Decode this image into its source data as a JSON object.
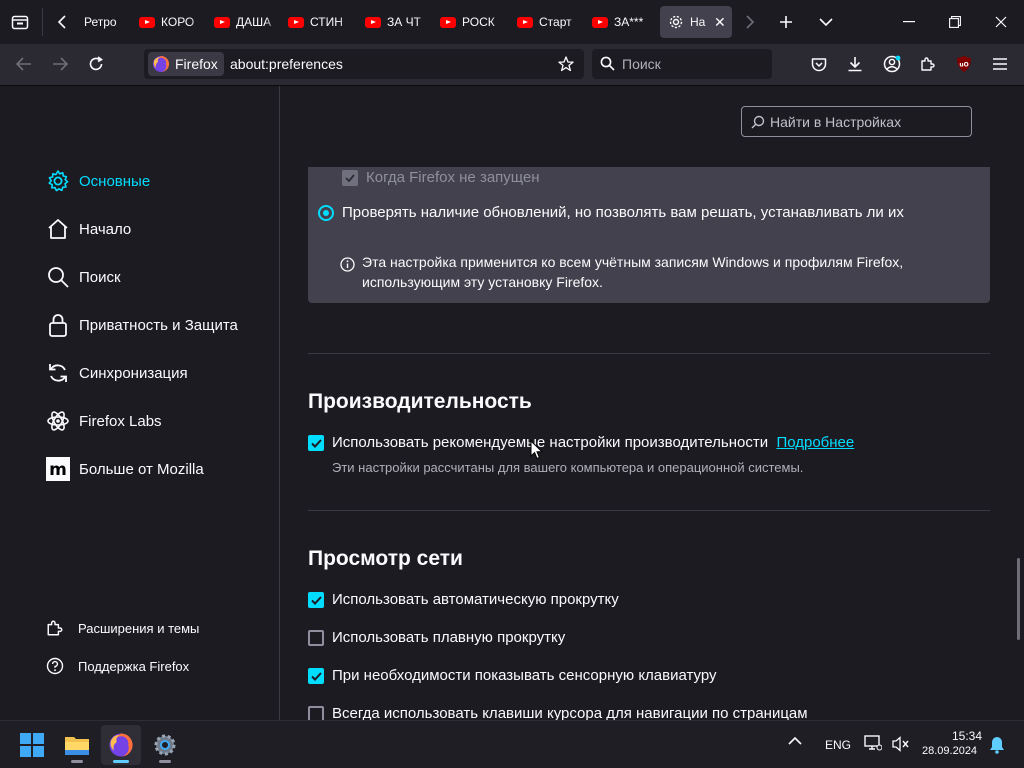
{
  "tabs": [
    {
      "label": "Ретро",
      "type": "plain"
    },
    {
      "label": "КОРО",
      "type": "youtube"
    },
    {
      "label": "ДАША",
      "type": "youtube"
    },
    {
      "label": "СТИН",
      "type": "youtube"
    },
    {
      "label": "ЗА ЧТ",
      "type": "youtube"
    },
    {
      "label": "РОСК",
      "type": "youtube"
    },
    {
      "label": "Старт",
      "type": "youtube"
    },
    {
      "label": "ЗА***",
      "type": "youtube"
    },
    {
      "label": "На",
      "type": "settings",
      "active": true
    }
  ],
  "navbar": {
    "identity_label": "Firefox",
    "url": "about:preferences",
    "search_placeholder": "Поиск"
  },
  "sidebar": {
    "categories": [
      {
        "label": "Основные",
        "icon": "gear-icon",
        "selected": true
      },
      {
        "label": "Начало",
        "icon": "home-icon"
      },
      {
        "label": "Поиск",
        "icon": "search-icon"
      },
      {
        "label": "Приватность и Защита",
        "icon": "lock-icon"
      },
      {
        "label": "Синхронизация",
        "icon": "sync-icon"
      },
      {
        "label": "Firefox Labs",
        "icon": "labs-icon"
      },
      {
        "label": "Больше от Mozilla",
        "icon": "mozilla-icon"
      }
    ],
    "footer": [
      {
        "label": "Расширения и темы",
        "icon": "puzzle-icon"
      },
      {
        "label": "Поддержка Firefox",
        "icon": "help-icon"
      }
    ]
  },
  "pref_search_placeholder": "Найти в Настройках",
  "updates": {
    "when_not_running": "Когда Firefox не запущен",
    "check_option": "Проверять наличие обновлений, но позволять вам решать, устанавливать ли их",
    "info_line1": "Эта настройка применится ко всем учётным записям Windows и профилям Firefox,",
    "info_line2": "использующим эту установку Firefox."
  },
  "performance": {
    "heading": "Производительность",
    "recommended_label": "Использовать рекомендуемые настройки производительности",
    "learn_more": "Подробнее",
    "recommended_desc": "Эти настройки рассчитаны для вашего компьютера и операционной системы.",
    "recommended_checked": true
  },
  "browsing": {
    "heading": "Просмотр сети",
    "items": [
      {
        "label": "Использовать автоматическую прокрутку",
        "checked": true
      },
      {
        "label": "Использовать плавную прокрутку",
        "checked": false
      },
      {
        "label": "При необходимости показывать сенсорную клавиатуру",
        "checked": true
      },
      {
        "label": "Всегда использовать клавиши курсора для навигации по страницам",
        "checked": false
      }
    ]
  },
  "taskbar": {
    "language": "ENG",
    "time": "15:34",
    "date": "28.09.2024"
  },
  "colors": {
    "accent": "#00ddff",
    "background": "#1c1b22",
    "panel": "#42414d"
  }
}
